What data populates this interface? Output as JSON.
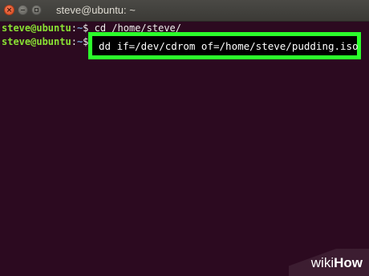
{
  "window": {
    "title": "steve@ubuntu: ~",
    "close_glyph": "×",
    "buttons": [
      "close-icon",
      "minimize-icon",
      "maximize-icon"
    ]
  },
  "terminal": {
    "colors": {
      "background": "#2c0a20",
      "prompt": "#8ae234",
      "path": "#729fcf",
      "text": "#eeeeec"
    },
    "lines": [
      {
        "user_host": "steve@ubuntu",
        "separator": ":",
        "path": "~",
        "symbol": "$",
        "command": " cd /home/steve/"
      },
      {
        "user_host": "steve@ubuntu",
        "separator": ":",
        "path": "~",
        "symbol": "$",
        "command": ""
      }
    ]
  },
  "highlight": {
    "command": "dd if=/dev/cdrom of=/home/steve/pudding.iso",
    "border_color": "#2bff2b"
  },
  "watermark": {
    "wiki": "wiki",
    "how": "How"
  }
}
